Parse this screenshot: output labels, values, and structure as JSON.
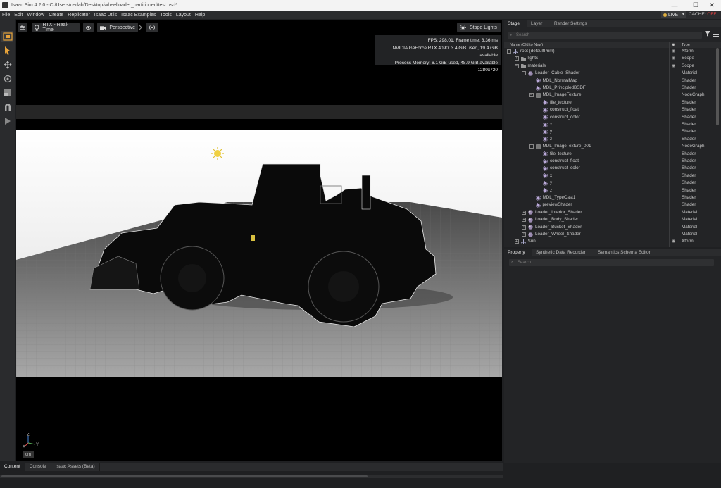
{
  "window": {
    "title": "Isaac Sim 4.2.0 - C:/Users/cerlab/Desktop/wheelloader_partitioned/test.usd*",
    "minimize_glyph": "—",
    "maximize_glyph": "☐",
    "close_glyph": "✕"
  },
  "menu": {
    "items": [
      "File",
      "Edit",
      "Window",
      "Create",
      "Replicator",
      "Isaac Utils",
      "Isaac Examples",
      "Tools",
      "Layout",
      "Help"
    ],
    "live_label": "LIVE",
    "live_dropdown": "▾",
    "cache_label": "CACHE:",
    "cache_value": "OFF"
  },
  "viewport": {
    "renderer_label": "RTX - Real-Time",
    "camera_label": "Perspective",
    "stage_lights_label": "Stage Lights",
    "stats": {
      "fps_line": "FPS: 298.01, Frame time: 3.36 ms",
      "gpu_line": "NVIDIA GeForce RTX 4090: 3.4 GiB used, 19.4 GiB available",
      "memory_line": "Process Memory: 6.1 GiB used, 48.9 GiB available",
      "resolution_line": "1280x720"
    },
    "axis_x": "X",
    "axis_y": "Y",
    "axis_z": "Z",
    "unit_badge": "cm"
  },
  "bottom_tabs": [
    "Content",
    "Console",
    "Isaac Assets (Beta)"
  ],
  "stage_panel": {
    "tabs": [
      "Stage",
      "Layer",
      "Render Settings"
    ],
    "search_placeholder": "Search",
    "col_name": "Name (Old to New)",
    "col_type": "Type",
    "rows": [
      {
        "label": "root (defaultPrim)",
        "type": "Xform",
        "depth": 0,
        "expand": "minus",
        "icon": "xform",
        "eye": true
      },
      {
        "label": "lights",
        "type": "Scope",
        "depth": 1,
        "expand": "plus",
        "icon": "folder",
        "eye": true
      },
      {
        "label": "materials",
        "type": "Scope",
        "depth": 1,
        "expand": "minus",
        "icon": "folder",
        "eye": true
      },
      {
        "label": "Loader_Cable_Shader",
        "type": "Material",
        "depth": 2,
        "expand": "minus",
        "icon": "material",
        "eye": false
      },
      {
        "label": "MDL_NormalMap",
        "type": "Shader",
        "depth": 3,
        "expand": "none",
        "icon": "shader",
        "eye": false
      },
      {
        "label": "MDL_PrincipledBSDF",
        "type": "Shader",
        "depth": 3,
        "expand": "none",
        "icon": "shader",
        "eye": false
      },
      {
        "label": "MDL_ImageTexture",
        "type": "NodeGraph",
        "depth": 3,
        "expand": "minus",
        "icon": "nodegraph",
        "eye": false
      },
      {
        "label": "file_texture",
        "type": "Shader",
        "depth": 4,
        "expand": "none",
        "icon": "shader",
        "eye": false
      },
      {
        "label": "construct_float",
        "type": "Shader",
        "depth": 4,
        "expand": "none",
        "icon": "shader",
        "eye": false
      },
      {
        "label": "construct_color",
        "type": "Shader",
        "depth": 4,
        "expand": "none",
        "icon": "shader",
        "eye": false
      },
      {
        "label": "x",
        "type": "Shader",
        "depth": 4,
        "expand": "none",
        "icon": "shader",
        "eye": false
      },
      {
        "label": "y",
        "type": "Shader",
        "depth": 4,
        "expand": "none",
        "icon": "shader",
        "eye": false
      },
      {
        "label": "z",
        "type": "Shader",
        "depth": 4,
        "expand": "none",
        "icon": "shader",
        "eye": false
      },
      {
        "label": "MDL_ImageTexture_001",
        "type": "NodeGraph",
        "depth": 3,
        "expand": "minus",
        "icon": "nodegraph",
        "eye": false
      },
      {
        "label": "file_texture",
        "type": "Shader",
        "depth": 4,
        "expand": "none",
        "icon": "shader",
        "eye": false
      },
      {
        "label": "construct_float",
        "type": "Shader",
        "depth": 4,
        "expand": "none",
        "icon": "shader",
        "eye": false
      },
      {
        "label": "construct_color",
        "type": "Shader",
        "depth": 4,
        "expand": "none",
        "icon": "shader",
        "eye": false
      },
      {
        "label": "x",
        "type": "Shader",
        "depth": 4,
        "expand": "none",
        "icon": "shader",
        "eye": false
      },
      {
        "label": "y",
        "type": "Shader",
        "depth": 4,
        "expand": "none",
        "icon": "shader",
        "eye": false
      },
      {
        "label": "z",
        "type": "Shader",
        "depth": 4,
        "expand": "none",
        "icon": "shader",
        "eye": false
      },
      {
        "label": "MDL_TypeCast1",
        "type": "Shader",
        "depth": 3,
        "expand": "none",
        "icon": "shader",
        "eye": false
      },
      {
        "label": "previewShader",
        "type": "Shader",
        "depth": 3,
        "expand": "none",
        "icon": "shader",
        "eye": false
      },
      {
        "label": "Loader_Interior_Shader",
        "type": "Material",
        "depth": 2,
        "expand": "plus",
        "icon": "material",
        "eye": false
      },
      {
        "label": "Loader_Body_Shader",
        "type": "Material",
        "depth": 2,
        "expand": "plus",
        "icon": "material",
        "eye": false
      },
      {
        "label": "Loader_Bucket_Shader",
        "type": "Material",
        "depth": 2,
        "expand": "plus",
        "icon": "material",
        "eye": false
      },
      {
        "label": "Loader_Wheel_Shader",
        "type": "Material",
        "depth": 2,
        "expand": "plus",
        "icon": "material",
        "eye": false
      },
      {
        "label": "Sun",
        "type": "Xform",
        "depth": 1,
        "expand": "plus",
        "icon": "xform",
        "eye": true
      }
    ]
  },
  "property_panel": {
    "tabs": [
      "Property",
      "Synthetic Data Recorder",
      "Semantics Schema Editor"
    ],
    "search_placeholder": "Search"
  },
  "colors": {
    "accent_orange": "#e8a33a",
    "live_dot": "#e0b040",
    "cache_off": "#e04040"
  }
}
